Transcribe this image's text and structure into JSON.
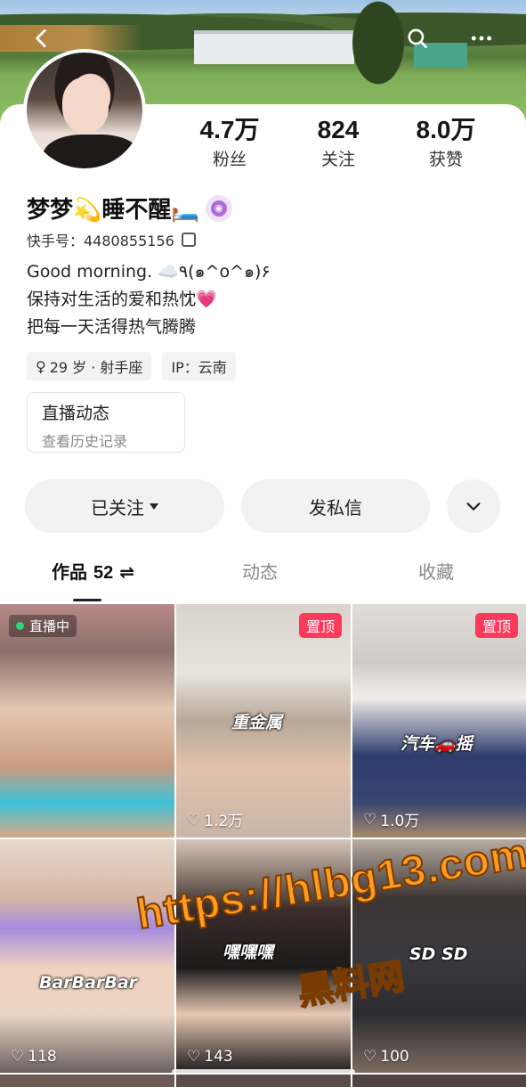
{
  "profile": {
    "name": "梦梦💫睡不醒🛏️",
    "kuaishou_id": "快手号：4480855156",
    "bio_lines": [
      "Good morning. ☁️٩(๑^o^๑)۶",
      "保持对生活的爱和热忱💗",
      "把每一天活得热气腾腾"
    ],
    "tags": [
      {
        "icon": "female-icon",
        "text": "29 岁 · 射手座"
      },
      {
        "icon": "",
        "text": "IP：云南"
      }
    ]
  },
  "stats": [
    {
      "value": "4.7万",
      "label": "粉丝"
    },
    {
      "value": "824",
      "label": "关注"
    },
    {
      "value": "8.0万",
      "label": "获赞"
    }
  ],
  "live_card": {
    "title": "直播动态",
    "subtitle": "查看历史记录"
  },
  "actions": {
    "follow": "已关注",
    "message": "发私信"
  },
  "tabs": [
    {
      "label": "作品",
      "count": "52",
      "active": true
    },
    {
      "label": "动态",
      "active": false
    },
    {
      "label": "收藏",
      "active": false
    }
  ],
  "grid": [
    {
      "likes": "",
      "pinned": false,
      "live": "直播中",
      "overlay": ""
    },
    {
      "likes": "1.2万",
      "pinned": true,
      "pin_label": "置顶",
      "overlay": "重金属"
    },
    {
      "likes": "1.0万",
      "pinned": true,
      "pin_label": "置顶",
      "overlay": "汽车🚗摇"
    },
    {
      "likes": "118",
      "pinned": false,
      "overlay": "BarBarBar"
    },
    {
      "likes": "143",
      "pinned": false,
      "overlay": "嘿嘿嘿"
    },
    {
      "likes": "100",
      "pinned": false,
      "overlay": "SD SD"
    }
  ],
  "watermark": {
    "url": "https://hlbg13.com",
    "label": "黑料网"
  },
  "colors": {
    "accent_pink": "#fe3a5c",
    "live_green": "#2fd67a",
    "watermark_orange": "#ff9b1f"
  }
}
